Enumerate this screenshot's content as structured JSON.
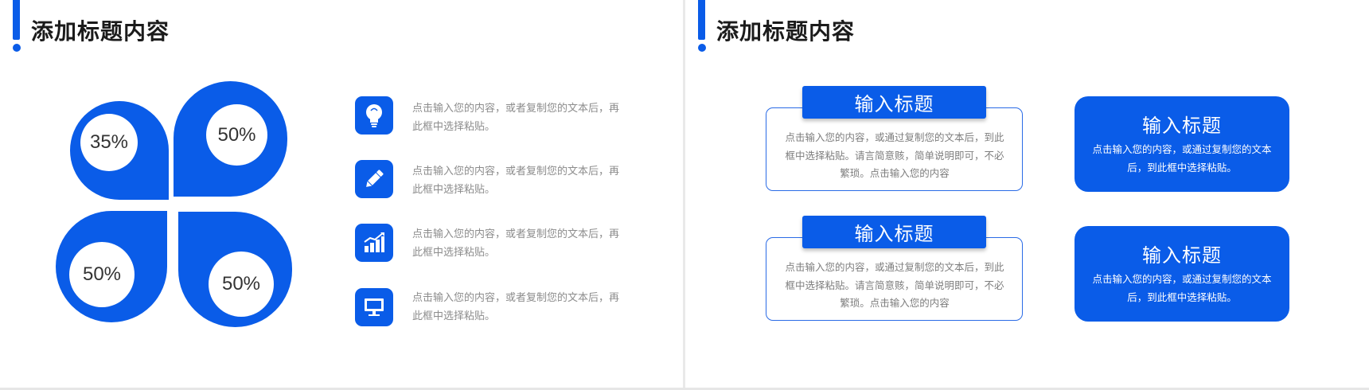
{
  "left_slide": {
    "title": "添加标题内容",
    "percentages": [
      "35%",
      "50%",
      "50%",
      "50%"
    ],
    "items": [
      {
        "icon": "lightbulb-icon",
        "text": "点击输入您的内容，或者复制您的文本后，再此框中选择粘贴。"
      },
      {
        "icon": "pencil-icon",
        "text": "点击输入您的内容，或者复制您的文本后，再此框中选择粘贴。"
      },
      {
        "icon": "bar-chart-icon",
        "text": "点击输入您的内容，或者复制您的文本后，再此框中选择粘贴。"
      },
      {
        "icon": "monitor-icon",
        "text": "点击输入您的内容，或者复制您的文本后，再此框中选择粘贴。"
      }
    ]
  },
  "right_slide": {
    "title": "添加标题内容",
    "outline_cards": [
      {
        "title": "输入标题",
        "text": "点击输入您的内容，或通过复制您的文本后，到此框中选择粘贴。请言简意赅，简单说明即可，不必繁琐。点击输入您的内容"
      },
      {
        "title": "输入标题",
        "text": "点击输入您的内容，或通过复制您的文本后，到此框中选择粘贴。请言简意赅，简单说明即可，不必繁琐。点击输入您的内容"
      }
    ],
    "solid_cards": [
      {
        "title": "输入标题",
        "text": "点击输入您的内容，或通过复制您的文本后，到此框中选择粘贴。"
      },
      {
        "title": "输入标题",
        "text": "点击输入您的内容，或通过复制您的文本后，到此框中选择粘贴。"
      }
    ]
  },
  "colors": {
    "accent": "#0a5ce8",
    "body_text": "#8c8c8c",
    "title_text": "#1b1b1b"
  }
}
